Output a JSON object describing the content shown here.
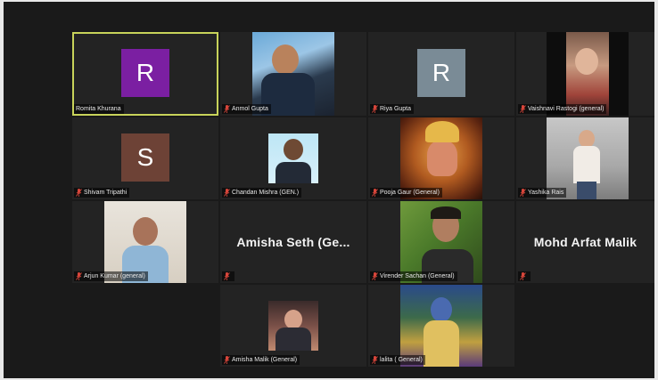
{
  "colors": {
    "background": "#1a1a1a",
    "tile": "#232323",
    "active_border": "#c8d35a",
    "muted_mic": "#d9463b"
  },
  "participants": [
    {
      "name": "Romita Khurana",
      "avatar_letter": "R",
      "avatar_color": "#7b1fa2",
      "muted": false,
      "active_speaker": true
    },
    {
      "name": "Anmol Gupta",
      "muted": true,
      "video": "photo"
    },
    {
      "name": "Riya Gupta",
      "avatar_letter": "R",
      "avatar_color": "#7a8b96",
      "muted": true
    },
    {
      "name": "Vaishnavi Rastogi (general)",
      "muted": true,
      "video": "photo"
    },
    {
      "name": "Shivam Tripathi",
      "avatar_letter": "S",
      "avatar_color": "#6d4236",
      "muted": true
    },
    {
      "name": "Chandan Mishra (GEN.)",
      "muted": true,
      "video": "photo"
    },
    {
      "name": "Pooja Gaur (General)",
      "muted": true,
      "video": "photo"
    },
    {
      "name": "Yashika Rais",
      "muted": true,
      "video": "photo"
    },
    {
      "name": "Arjun Kumar (general)",
      "muted": true,
      "video": "photo"
    },
    {
      "name": "",
      "display_name": "Amisha Seth (Ge...",
      "muted": true,
      "video": "off"
    },
    {
      "name": "Virender Sachan (General)",
      "muted": true,
      "video": "photo"
    },
    {
      "name": "",
      "display_name": "Mohd Arfat Malik",
      "muted": true,
      "video": "off"
    },
    {
      "name": "Amisha Malik (General)",
      "muted": true,
      "video": "photo"
    },
    {
      "name": "lalita ( General)",
      "muted": true,
      "video": "photo"
    }
  ]
}
